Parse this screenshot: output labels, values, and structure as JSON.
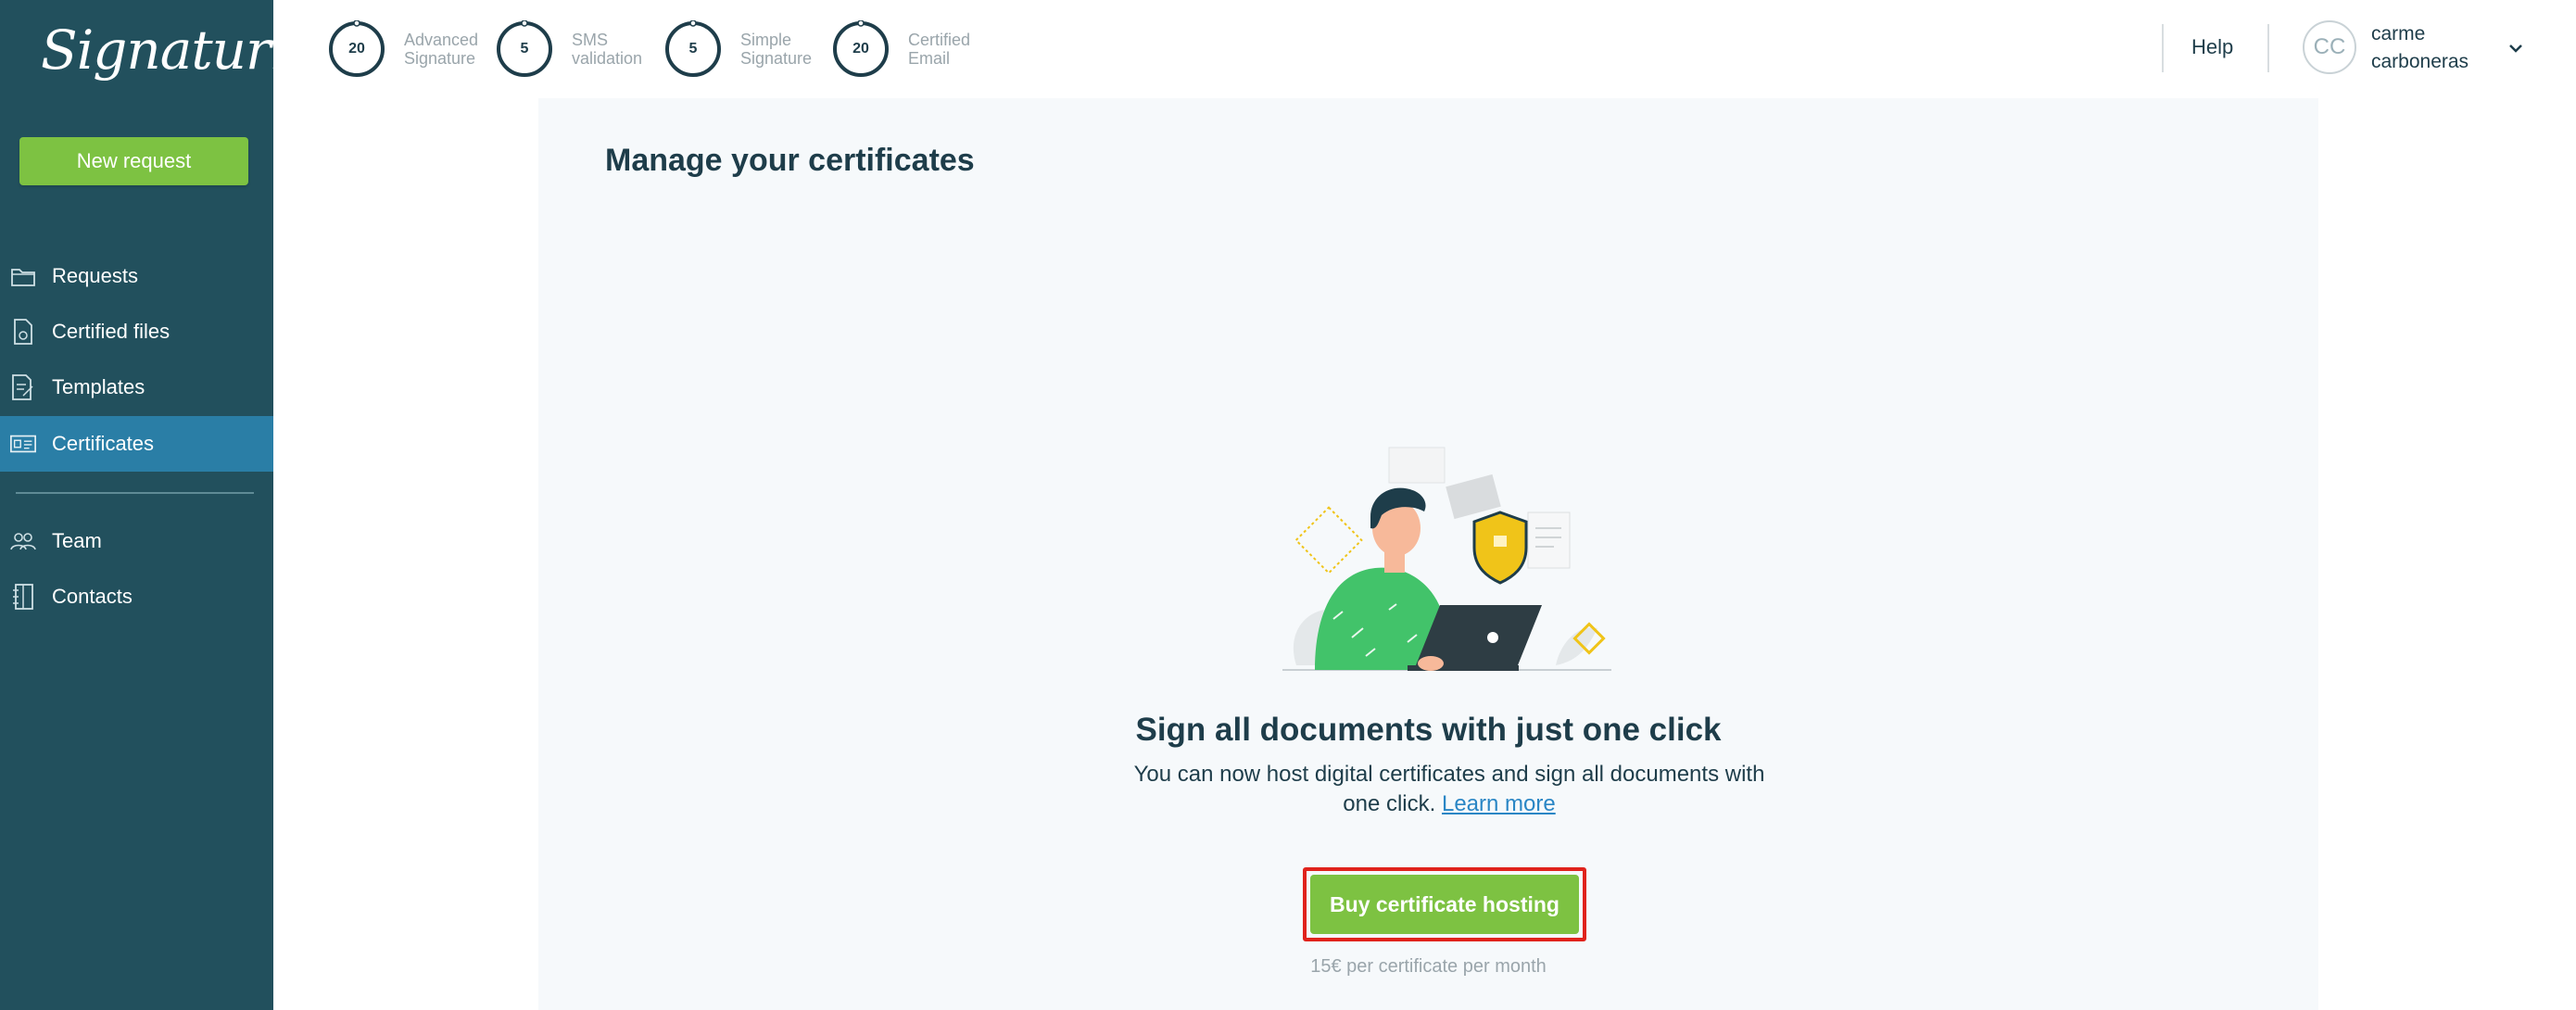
{
  "sidebar": {
    "logo_text": "Signaturit",
    "new_request_label": "New request",
    "items": [
      {
        "label": "Requests",
        "icon": "folder-icon"
      },
      {
        "label": "Certified files",
        "icon": "certified-file-icon"
      },
      {
        "label": "Templates",
        "icon": "template-icon"
      },
      {
        "label": "Certificates",
        "icon": "certificate-card-icon",
        "active": true
      },
      {
        "label": "Team",
        "icon": "team-icon"
      },
      {
        "label": "Contacts",
        "icon": "contacts-book-icon"
      }
    ]
  },
  "header": {
    "counters": [
      {
        "value": "20",
        "label_1": "Advanced",
        "label_2": "Signature"
      },
      {
        "value": "5",
        "label_1": "SMS",
        "label_2": "validation"
      },
      {
        "value": "5",
        "label_1": "Simple",
        "label_2": "Signature"
      },
      {
        "value": "20",
        "label_1": "Certified",
        "label_2": "Email"
      }
    ],
    "help_label": "Help",
    "user": {
      "initials": "CC",
      "first_name": "carme",
      "last_name": "carboneras"
    }
  },
  "main": {
    "title": "Manage your certificates",
    "empty_heading": "Sign all documents with just one click",
    "empty_text": "You can now host digital certificates and sign all documents with one click.",
    "learn_more_label": "Learn more",
    "buy_button_label": "Buy certificate hosting",
    "price_note": "15€ per certificate per month"
  },
  "colors": {
    "sidebar_bg": "#22505d",
    "sidebar_active": "#2a7ea6",
    "accent_green": "#7dc242",
    "highlight_red": "#e0231c",
    "text_dark": "#1e3d4a",
    "link_blue": "#2a86c5"
  }
}
